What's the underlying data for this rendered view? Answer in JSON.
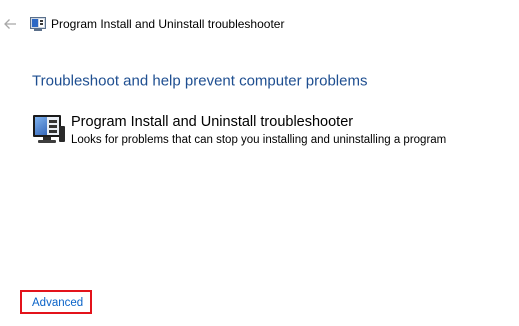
{
  "header": {
    "back_icon": "back-arrow-icon",
    "window_icon": "troubleshooter-icon",
    "title": "Program Install and Uninstall troubleshooter"
  },
  "main": {
    "heading": "Troubleshoot and help prevent computer problems",
    "troubleshooter": {
      "icon": "computer-monitor-icon",
      "title": "Program Install and Uninstall troubleshooter",
      "description": "Looks for problems that can stop you installing and uninstalling a program"
    }
  },
  "footer": {
    "advanced_label": "Advanced"
  },
  "colors": {
    "heading": "#1e4e90",
    "link": "#0a63c8",
    "highlight_border": "#e3131b"
  }
}
